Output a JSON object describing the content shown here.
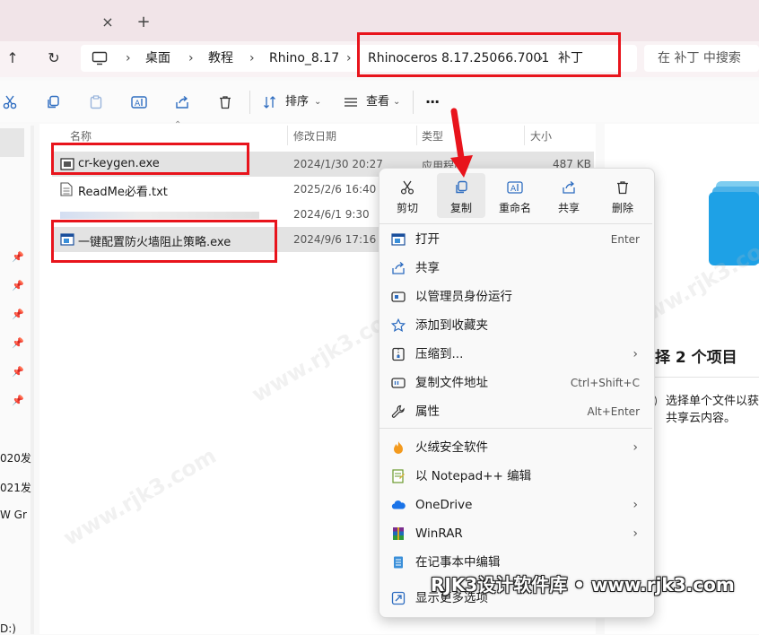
{
  "window": {
    "tab_close_glyph": "×",
    "tab_new_glyph": "+"
  },
  "navigation": {
    "up_glyph": "↑",
    "refresh_glyph": "↻"
  },
  "breadcrumb": {
    "items": [
      "桌面",
      "教程",
      "Rhino_8.17",
      "Rhinoceros 8.17.25066.7001",
      "补丁"
    ],
    "separator": "›"
  },
  "search": {
    "placeholder": "在 补丁 中搜索"
  },
  "toolbar": {
    "sort_label": "排序",
    "view_label": "查看",
    "more_label": "···"
  },
  "columns": {
    "name": "名称",
    "modified": "修改日期",
    "type": "类型",
    "size": "大小"
  },
  "files": [
    {
      "name": "cr-keygen.exe",
      "date": "2024/1/30 20:27",
      "type": "应用程序",
      "size": "487 KB",
      "selected": true
    },
    {
      "name": "ReadMe必看.txt",
      "date": "2025/2/6 16:40",
      "type": "",
      "size": "",
      "selected": false
    },
    {
      "name": "",
      "date": "2024/6/1 9:30",
      "type": "",
      "size": "",
      "selected": false
    },
    {
      "name": "一键配置防火墙阻止策略.exe",
      "date": "2024/9/6 17:16",
      "type": "",
      "size": "",
      "selected": true
    }
  ],
  "leftnav": {
    "items": [
      "020发",
      "021发",
      "W Gr",
      "D:)"
    ]
  },
  "context_menu": {
    "quick_actions": [
      {
        "label": "剪切",
        "icon": "scissors-icon"
      },
      {
        "label": "复制",
        "icon": "copy-icon"
      },
      {
        "label": "重命名",
        "icon": "rename-icon"
      },
      {
        "label": "共享",
        "icon": "share-icon"
      },
      {
        "label": "删除",
        "icon": "trash-icon"
      }
    ],
    "items": [
      {
        "label": "打开",
        "shortcut": "Enter",
        "submenu": false,
        "icon": "app-window-icon"
      },
      {
        "label": "共享",
        "shortcut": "",
        "submenu": false,
        "icon": "share-icon"
      },
      {
        "label": "以管理员身份运行",
        "shortcut": "",
        "submenu": false,
        "icon": "admin-shield-icon"
      },
      {
        "label": "添加到收藏夹",
        "shortcut": "",
        "submenu": false,
        "icon": "star-icon"
      },
      {
        "label": "压缩到...",
        "shortcut": "",
        "submenu": true,
        "icon": "zip-icon"
      },
      {
        "label": "复制文件地址",
        "shortcut": "Ctrl+Shift+C",
        "submenu": false,
        "icon": "copy-path-icon"
      },
      {
        "label": "属性",
        "shortcut": "Alt+Enter",
        "submenu": false,
        "icon": "wrench-icon"
      },
      {
        "label": "火绒安全软件",
        "shortcut": "",
        "submenu": true,
        "icon": "huorong-icon"
      },
      {
        "label": "以 Notepad++ 编辑",
        "shortcut": "",
        "submenu": false,
        "icon": "notepadpp-icon"
      },
      {
        "label": "OneDrive",
        "shortcut": "",
        "submenu": true,
        "icon": "cloud-icon"
      },
      {
        "label": "WinRAR",
        "shortcut": "",
        "submenu": true,
        "icon": "winrar-icon"
      },
      {
        "label": "在记事本中编辑",
        "shortcut": "",
        "submenu": false,
        "icon": "notepad-icon"
      },
      {
        "label": "显示更多选项",
        "shortcut": "",
        "submenu": false,
        "icon": "more-options-icon"
      }
    ],
    "submenu_glyph": "›"
  },
  "details": {
    "title": "择 2 个项目",
    "info_line1": "选择单个文件以获",
    "info_line2": "共享云内容。",
    "info_glyph": "i"
  },
  "watermark": {
    "caption": "RJK3设计软件库 • www.rjk3.com",
    "background_text": "www.rjk3.com"
  },
  "colors": {
    "highlight_red": "#e8141c",
    "accent_blue": "#2d6cc0",
    "tabstrip": "#f1e4e8"
  }
}
